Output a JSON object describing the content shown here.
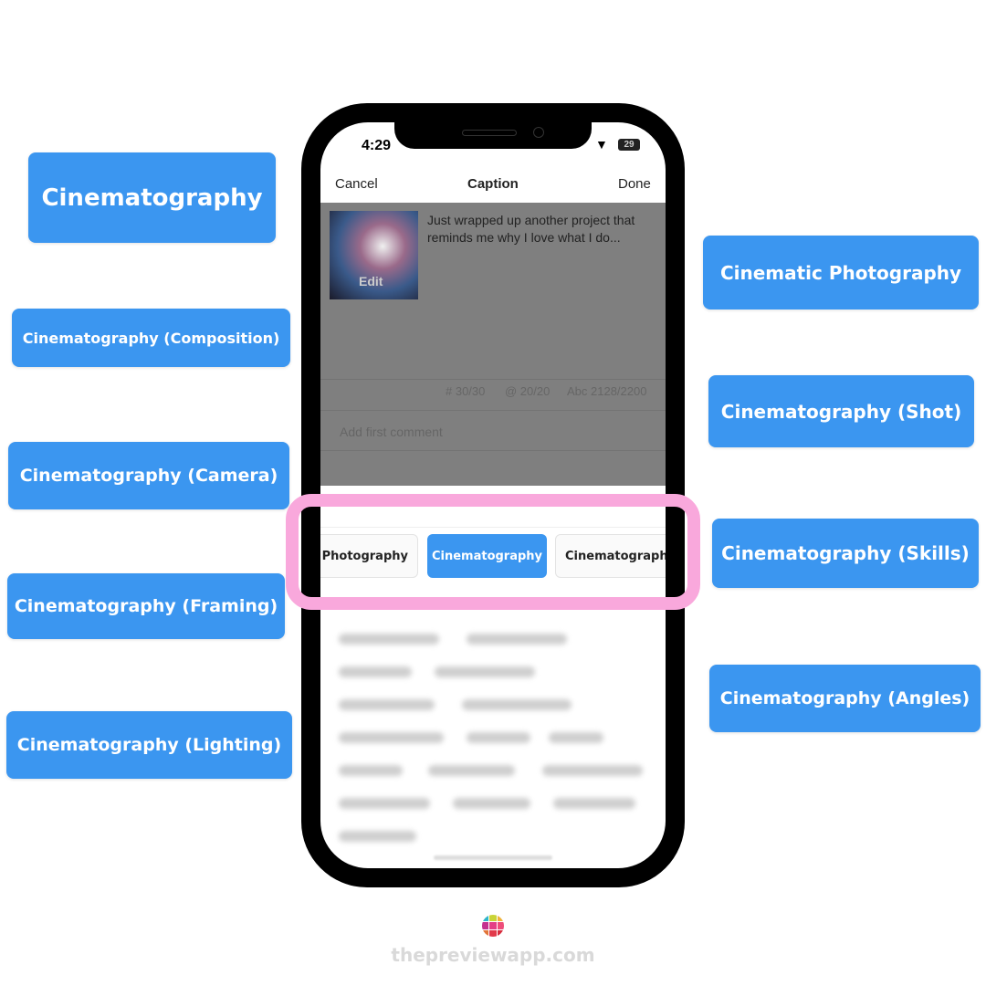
{
  "labels_left": [
    "Cinematography",
    "Cinematography (Composition)",
    "Cinematography (Camera)",
    "Cinematography (Framing)",
    "Cinematography (Lighting)"
  ],
  "labels_right": [
    "Cinematic Photography",
    "Cinematography (Shot)",
    "Cinematography (Skills)",
    "Cinematography (Angles)"
  ],
  "status": {
    "time": "4:29",
    "battery": "29"
  },
  "nav": {
    "cancel": "Cancel",
    "title": "Caption",
    "done": "Done"
  },
  "post": {
    "edit": "Edit",
    "caption": "Just wrapped up another project that reminds me why I love what I do..."
  },
  "counters": {
    "hashtags": "# 30/30",
    "mentions": "@ 20/20",
    "chars": "Abc 2128/2200"
  },
  "comment_placeholder": "Add first comment",
  "chips": [
    "c Photography",
    "Cinematography",
    "Cinematography"
  ],
  "colors": {
    "accent": "#3b96f0",
    "highlight": "#f9a8dc"
  },
  "footer": {
    "site": "thepreviewapp.com"
  }
}
